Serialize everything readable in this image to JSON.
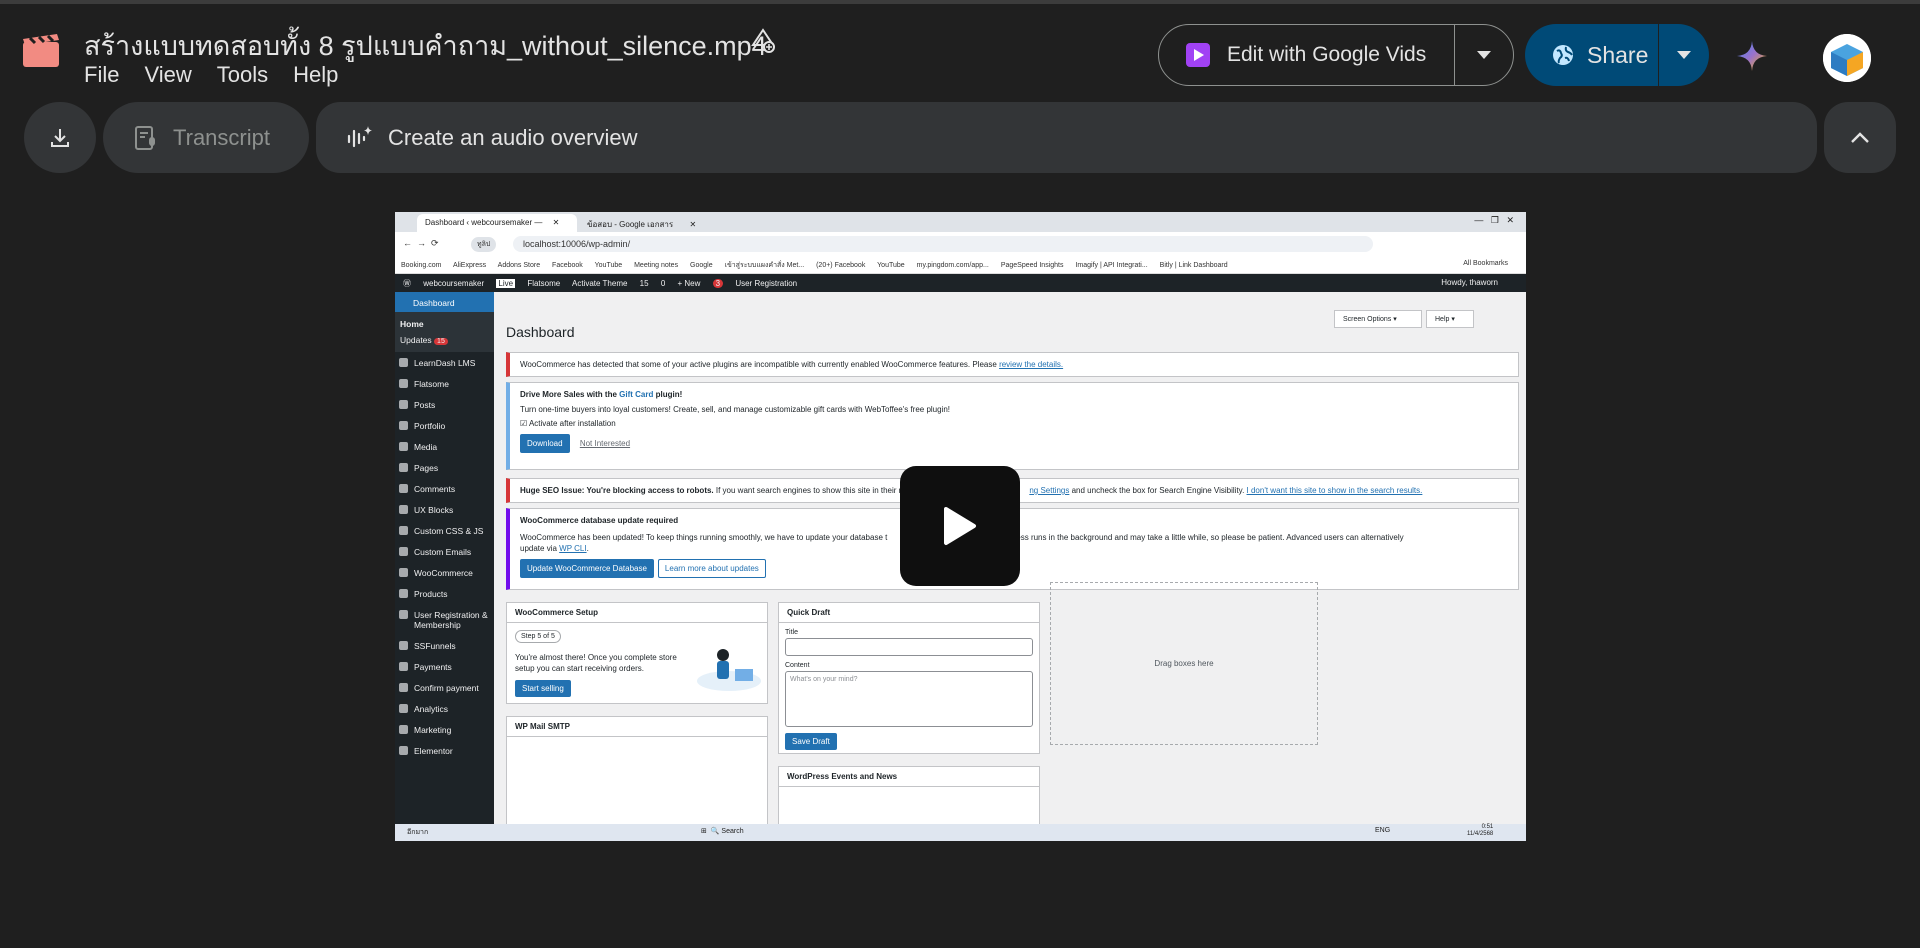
{
  "window": {
    "title": "สร้างแบบทดสอบทั้ง 8 รูปแบบคำถาม_without_silence.mp4",
    "menu": [
      "File",
      "View",
      "Tools",
      "Help"
    ]
  },
  "header_actions": {
    "edit_vids_label": "Edit with Google Vids",
    "share_label": "Share"
  },
  "toolbar": {
    "transcript_label": "Transcript",
    "audio_overview_label": "Create an audio overview"
  },
  "video_frame": {
    "tabs": [
      "Dashboard ‹ webcoursemaker —",
      "ข้อสอบ - Google เอกสาร"
    ],
    "url": "localhost:10006/wp-admin/",
    "url_chip": "ทูลิป",
    "bookmarks": [
      "Booking.com",
      "AliExpress",
      "Addons Store",
      "Facebook",
      "YouTube",
      "Meeting notes",
      "Google",
      "เข้าสู่ระบบแผงคำสั่ง Met...",
      "(20+) Facebook",
      "YouTube",
      "my.pingdom.com/app...",
      "PageSpeed Insights",
      "Imagify | API Integrati...",
      "Bitly | Link Dashboard",
      "All Bookmarks"
    ],
    "adminbar": [
      "webcoursemaker",
      "Live",
      "Flatsome",
      "Activate Theme",
      "15",
      "0",
      "+ New",
      "3",
      "User Registration"
    ],
    "howdy": "Howdy, thaworn",
    "sidebar": {
      "dashboard": "Dashboard",
      "home": "Home",
      "updates": "Updates",
      "updates_count": "15",
      "items": [
        "LearnDash LMS",
        "Flatsome",
        "Posts",
        "Portfolio",
        "Media",
        "Pages",
        "Comments",
        "UX Blocks",
        "Custom CSS & JS",
        "Custom Emails",
        "WooCommerce",
        "Products",
        "User Registration & Membership",
        "SSFunnels",
        "Payments",
        "Confirm payment",
        "Analytics",
        "Marketing",
        "Elementor"
      ]
    },
    "page_title": "Dashboard",
    "screen_options": "Screen Options ▾",
    "help": "Help ▾",
    "notices": {
      "woo_incompat": "WooCommerce has detected that some of your active plugins are incompatible with currently enabled WooCommerce features. Please",
      "woo_incompat_link": "review the details.",
      "gift_title_pre": "Drive More Sales with the",
      "gift_title_link": "Gift Card",
      "gift_title_post": "plugin!",
      "gift_body": "Turn one-time buyers into loyal customers! Create, sell, and manage customizable gift cards with WebToffee's free plugin!",
      "gift_checkbox": "Activate after installation",
      "gift_download": "Download",
      "gift_not_interested": "Not Interested",
      "seo_bold": "Huge SEO Issue: You're blocking access to robots.",
      "seo_text": "If you want search engines to show this site in their r",
      "seo_text2": "ng Settings",
      "seo_text3": "and uncheck the box for Search Engine Visibility.",
      "seo_link": "I don't want this site to show in the search results.",
      "db_title": "WooCommerce database update required",
      "db_body": "WooCommerce has been updated! To keep things running smoothly, we have to update your database t",
      "db_body2": "se update process runs in the background and may take a little while, so please be patient. Advanced users can alternatively",
      "db_body3_pre": "update via",
      "db_body3_link": "WP CLI",
      "db_btn": "Update WooCommerce Database",
      "db_btn2": "Learn more about updates"
    },
    "boxes": {
      "setup_title": "WooCommerce Setup",
      "setup_step": "Step 5 of 5",
      "setup_text": "You're almost there! Once you complete store setup you can start receiving orders.",
      "setup_btn": "Start selling",
      "smtp_title": "WP Mail SMTP",
      "draft_title": "Quick Draft",
      "draft_title_label": "Title",
      "draft_content_label": "Content",
      "draft_placeholder": "What's on your mind?",
      "draft_save": "Save Draft",
      "events_title": "WordPress Events and News",
      "drag": "Drag boxes here"
    },
    "taskbar": {
      "search": "Search",
      "lang": "ENG",
      "time": "0:51",
      "date": "11/4/2568",
      "weather": "อีกมาก"
    }
  },
  "colors": {
    "background": "#1f1f1f",
    "button_bg": "#333537",
    "share_bg": "#004a77",
    "app_icon": "#f28b82"
  },
  "icons": {
    "app": "video-clapper-icon",
    "title_action": "add-shortcut-icon",
    "vids": "google-vids-icon",
    "share": "globe-icon",
    "gemini": "gemini-sparkle-icon",
    "download": "download-icon",
    "transcript": "transcript-icon",
    "audio": "audio-sparkle-icon",
    "collapse": "chevron-up-icon",
    "play": "play-icon"
  }
}
